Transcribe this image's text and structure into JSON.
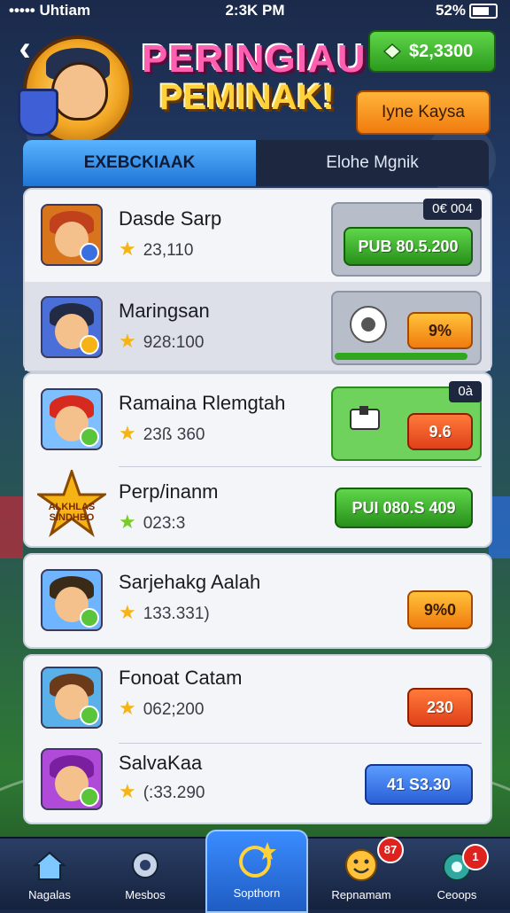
{
  "status_bar": {
    "carrier": "••••• Uhtiam",
    "time": "2:3K PM",
    "battery": "52%"
  },
  "header": {
    "title_line1": "PERINGIAU",
    "title_line2": "PEMINAK!",
    "coins": "$2,3300",
    "action_button": "Iyne Kaysa"
  },
  "tabs": [
    {
      "label": "EXEBCKIAAK",
      "active": true
    },
    {
      "label": "Elohe Mgnik",
      "active": false
    }
  ],
  "leaderboard": [
    {
      "name": "Dasde Sarp",
      "score": "23,110",
      "tag": "0€ 004",
      "reward": "PUB 80.5.200",
      "reward_style": "green"
    },
    {
      "name": "Maringsan",
      "score": "928:100",
      "reward": "9%",
      "reward_style": "orange"
    },
    {
      "name": "Ramaina Rlemgtah",
      "score": "23ß 360",
      "tag": "0à",
      "reward": "9.6",
      "reward_style": "red"
    },
    {
      "name": "Perp/inanm",
      "score": "023:3",
      "reward": "PUI 080.S 409",
      "reward_style": "green",
      "avatar_text": "ALKHLAS SINDHBO"
    },
    {
      "name": "Sarjehakg Aalah",
      "score": "133.331)",
      "reward": "9%0",
      "reward_style": "orange"
    },
    {
      "name": "Fonoat Catam",
      "score": "062;200",
      "reward": "230",
      "reward_style": "red"
    },
    {
      "name": "SalvaKaa",
      "score": "(:33.290",
      "reward": "41 S3.30",
      "reward_style": "blue"
    }
  ],
  "bottom_nav": [
    {
      "label": "Nagalas"
    },
    {
      "label": "Mesbos"
    },
    {
      "label": "Sopthorn",
      "active": true
    },
    {
      "label": "Repnamam",
      "badge": "87"
    },
    {
      "label": "Ceoops",
      "badge": "1"
    }
  ],
  "colors": {
    "accent_blue": "#1f74d6",
    "gold": "#ffd23a",
    "pink": "#ff5fb0",
    "green": "#2b9a1e",
    "orange": "#f07b0f"
  }
}
